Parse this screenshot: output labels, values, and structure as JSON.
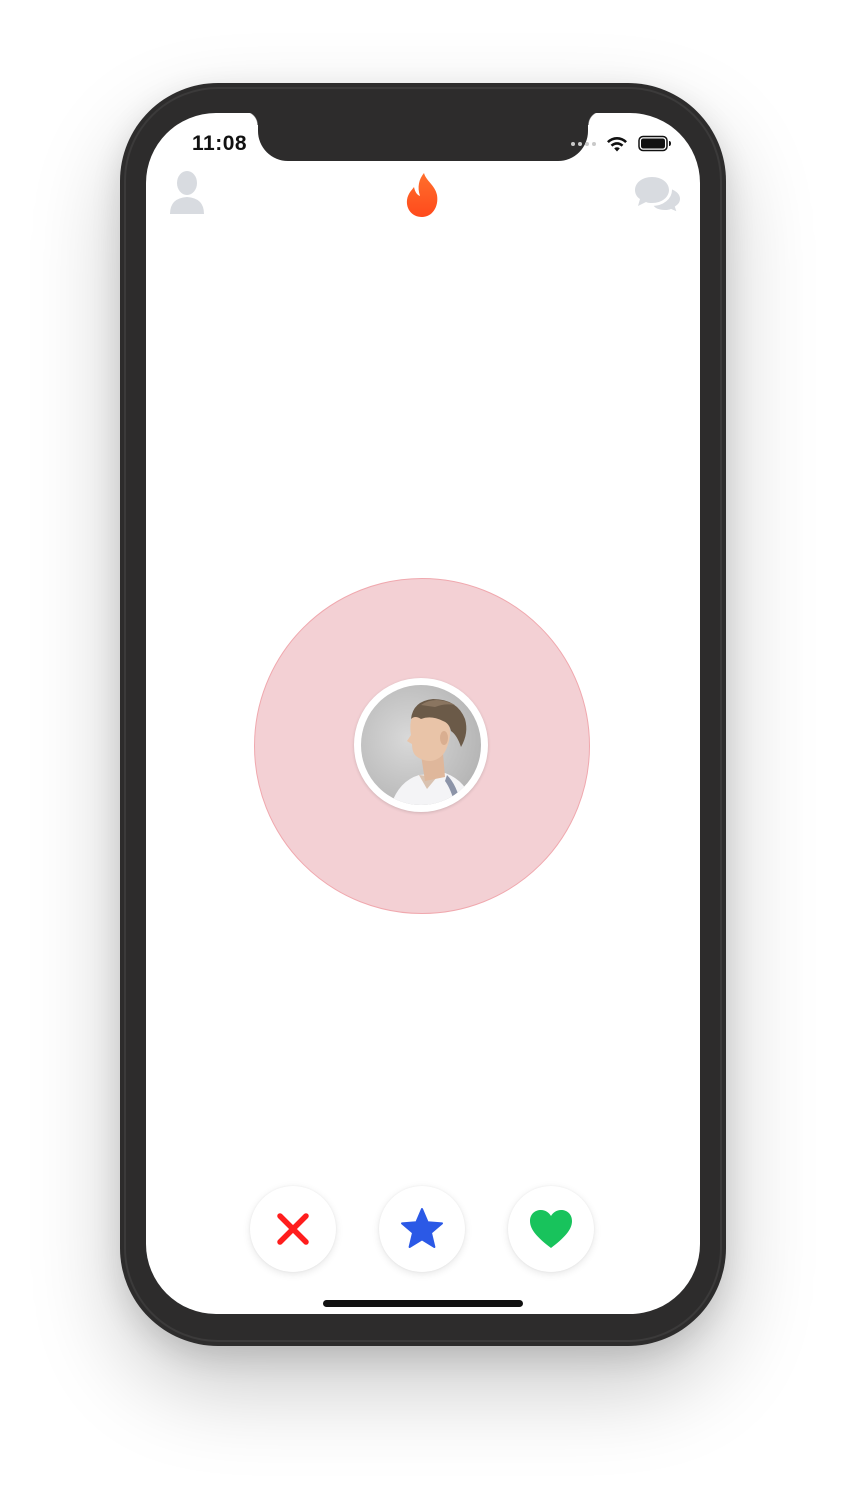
{
  "status_bar": {
    "time": "11:08"
  },
  "header": {
    "left_icon": "profile-icon",
    "center_icon": "flame-logo-icon",
    "right_icon": "chat-bubbles-icon"
  },
  "discovery": {
    "state": "searching",
    "avatar_icon": "profile-photo"
  },
  "actions": [
    {
      "icon": "close-icon",
      "color": "#ff1d1d"
    },
    {
      "icon": "star-icon",
      "color": "#2b59e6"
    },
    {
      "icon": "heart-icon",
      "color": "#18c35c"
    }
  ],
  "colors": {
    "brand": "#ff5a20",
    "pulse_fill": "#f3d0d4",
    "pulse_stroke": "#f0a8ae",
    "header_icons": "#d8dbe0",
    "device_frame": "#2d2c2c"
  }
}
